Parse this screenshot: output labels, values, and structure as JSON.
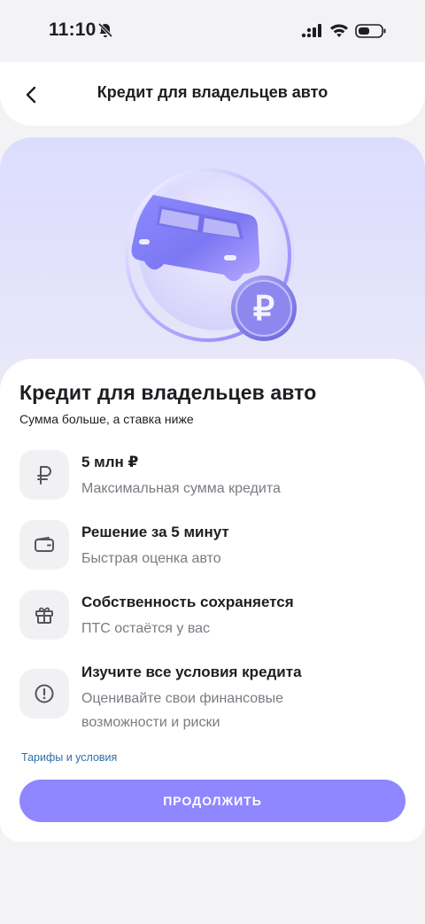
{
  "status_bar": {
    "time": "11:10"
  },
  "header": {
    "title": "Кредит для владельцев авто"
  },
  "card": {
    "title": "Кредит для владельцев авто",
    "subtitle": "Сумма больше, а ставка ниже",
    "features": [
      {
        "icon": "ruble-icon",
        "title": "5 млн ₽",
        "description": "Максимальная сумма кредита"
      },
      {
        "icon": "wallet-icon",
        "title": "Решение за 5 минут",
        "description": "Быстрая оценка авто"
      },
      {
        "icon": "gift-icon",
        "title": "Собственность сохраняется",
        "description": "ПТС остаётся у вас"
      },
      {
        "icon": "exclamation-circle-icon",
        "title": "Изучите все условия кредита",
        "description": "Оценивайте свои финансовые возможности и риски"
      }
    ],
    "tariffs_link": "Тарифы и условия",
    "continue_button": "ПРОДОЛЖИТЬ"
  },
  "colors": {
    "accent": "#8f87ff",
    "link": "#2f6fa8",
    "hero_bg": "#dcdcff"
  }
}
